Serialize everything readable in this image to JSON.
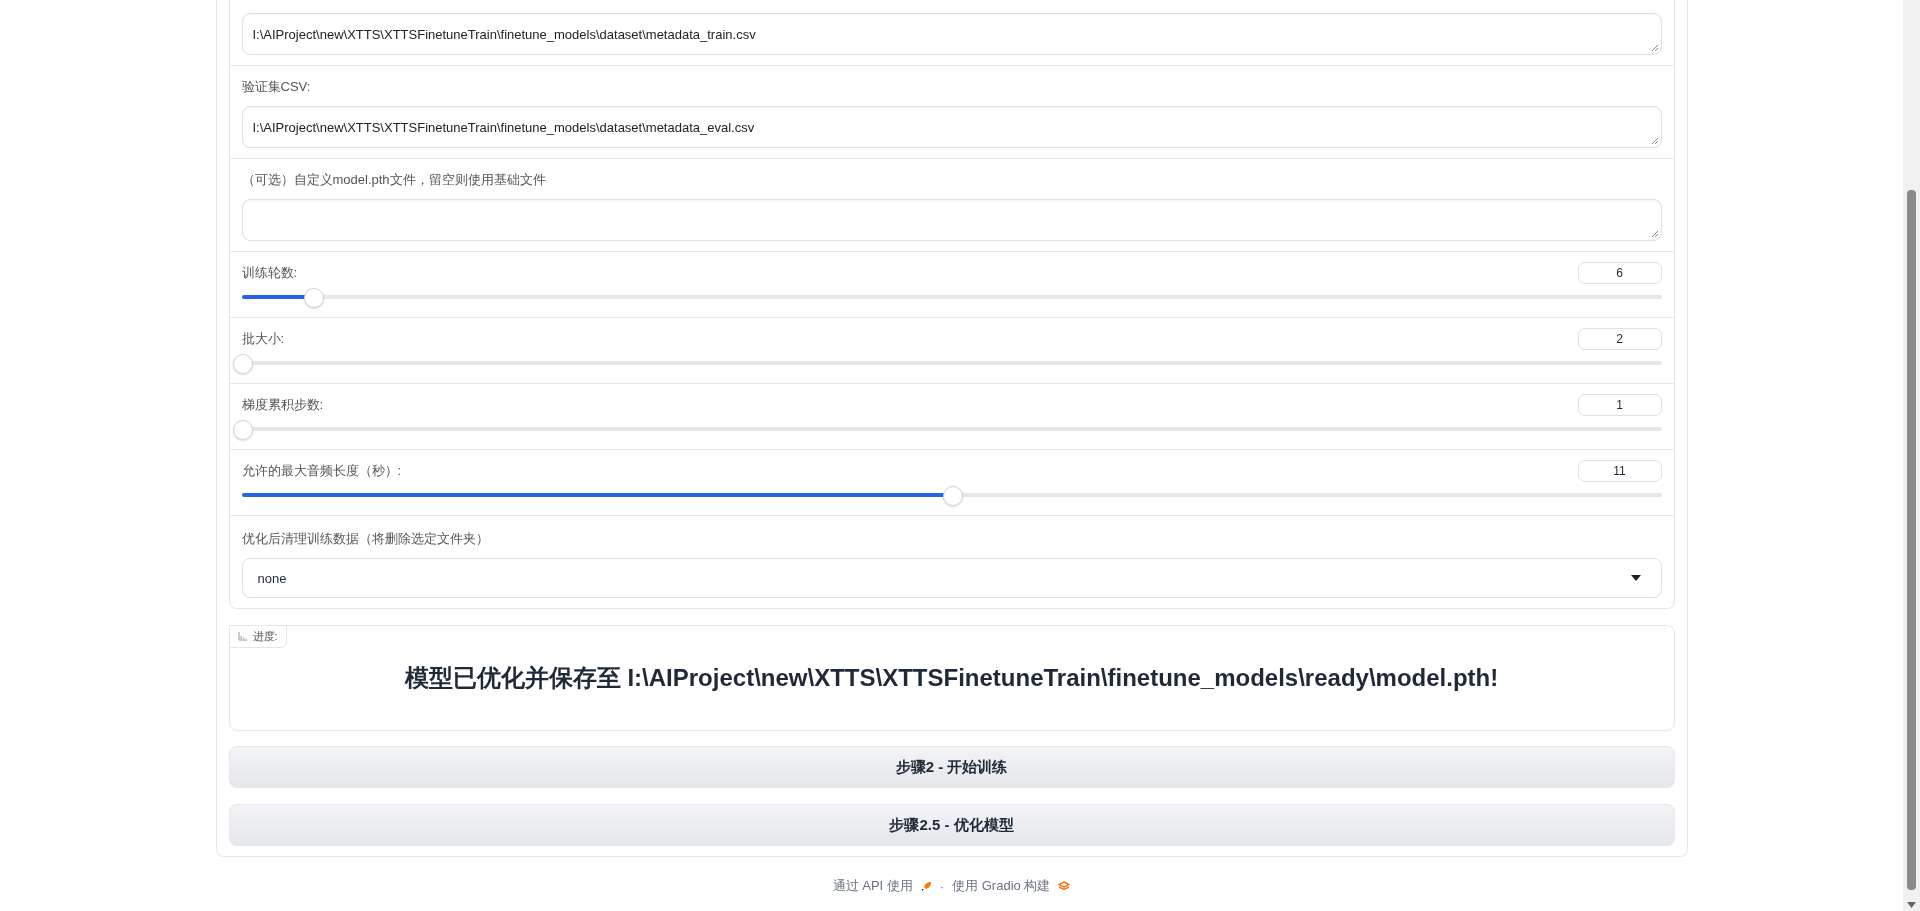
{
  "textboxes": [
    {
      "value": "I:\\AIProject\\new\\XTTS\\XTTSFinetuneTrain\\finetune_models\\dataset\\metadata_train.csv"
    },
    {
      "label": "验证集CSV:",
      "value": "I:\\AIProject\\new\\XTTS\\XTTSFinetuneTrain\\finetune_models\\dataset\\metadata_eval.csv"
    },
    {
      "label": "（可选）自定义model.pth文件，留空则使用基础文件"
    }
  ],
  "sliders": [
    {
      "label": "训练轮数:",
      "value": "6",
      "level": 0.05
    },
    {
      "label": "批大小:",
      "value": "2",
      "level": 0
    },
    {
      "label": "梯度累积步数:",
      "value": "1",
      "level": 0
    },
    {
      "label": "允许的最大音频长度（秒）:",
      "value": "11",
      "level": 0.5
    }
  ],
  "dropdown": {
    "label": "优化后清理训练数据（将删除选定文件夹）",
    "value": "none"
  },
  "progress": {
    "label": "进度:",
    "message": "模型已优化并保存至 I:\\AIProject\\new\\XTTS\\XTTSFinetuneTrain\\finetune_models\\ready\\model.pth!"
  },
  "buttons": [
    "步骤2 - 开始训练",
    "步骤2.5 - 优化模型"
  ],
  "footer": {
    "api_link": "通过 API 使用",
    "separator": "·",
    "built_with": "使用 Gradio 构建"
  }
}
